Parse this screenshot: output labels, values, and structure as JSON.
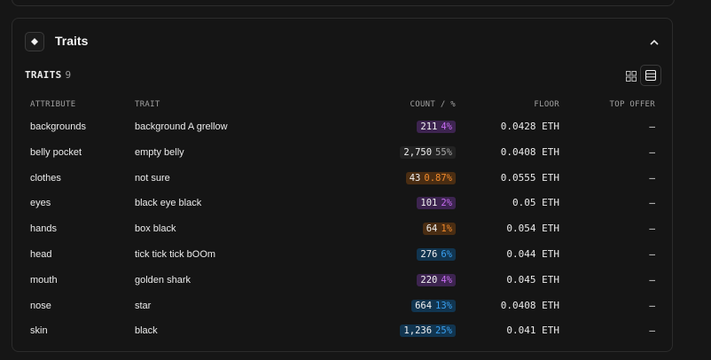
{
  "section": {
    "title": "Traits",
    "subheader_label": "TRAITS",
    "subheader_count": "9"
  },
  "table": {
    "headers": {
      "attribute": "ATTRIBUTE",
      "trait": "TRAIT",
      "count": "COUNT / %",
      "floor": "FLOOR",
      "top_offer": "TOP OFFER"
    },
    "rows": [
      {
        "attribute": "backgrounds",
        "trait": "background A grellow",
        "count": "211",
        "percent": "4%",
        "badge_color": "purple",
        "floor": "0.0428 ETH",
        "top_offer": "—"
      },
      {
        "attribute": "belly pocket",
        "trait": "empty belly",
        "count": "2,750",
        "percent": "55%",
        "badge_color": "gray",
        "floor": "0.0408 ETH",
        "top_offer": "—"
      },
      {
        "attribute": "clothes",
        "trait": "not sure",
        "count": "43",
        "percent": "0.87%",
        "badge_color": "orange",
        "floor": "0.0555 ETH",
        "top_offer": "—"
      },
      {
        "attribute": "eyes",
        "trait": "black eye black",
        "count": "101",
        "percent": "2%",
        "badge_color": "purple",
        "floor": "0.05 ETH",
        "top_offer": "—"
      },
      {
        "attribute": "hands",
        "trait": "box black",
        "count": "64",
        "percent": "1%",
        "badge_color": "orange",
        "floor": "0.054 ETH",
        "top_offer": "—"
      },
      {
        "attribute": "head",
        "trait": "tick tick tick bOOm",
        "count": "276",
        "percent": "6%",
        "badge_color": "blue",
        "floor": "0.044 ETH",
        "top_offer": "—"
      },
      {
        "attribute": "mouth",
        "trait": "golden shark",
        "count": "220",
        "percent": "4%",
        "badge_color": "purple",
        "floor": "0.045 ETH",
        "top_offer": "—"
      },
      {
        "attribute": "nose",
        "trait": "star",
        "count": "664",
        "percent": "13%",
        "badge_color": "blue",
        "floor": "0.0408 ETH",
        "top_offer": "—"
      },
      {
        "attribute": "skin",
        "trait": "black",
        "count": "1,236",
        "percent": "25%",
        "badge_color": "blue",
        "floor": "0.041 ETH",
        "top_offer": "—"
      }
    ]
  },
  "icons": {
    "section": "diamond-icon",
    "collapse": "chevron-up-icon",
    "grid_view": "grid-view-icon",
    "table_view": "table-view-icon"
  },
  "colors": {
    "background": "#161616",
    "purple_pct": "#c66cf0",
    "orange_pct": "#f08a2c",
    "blue_pct": "#3aa0f0"
  }
}
